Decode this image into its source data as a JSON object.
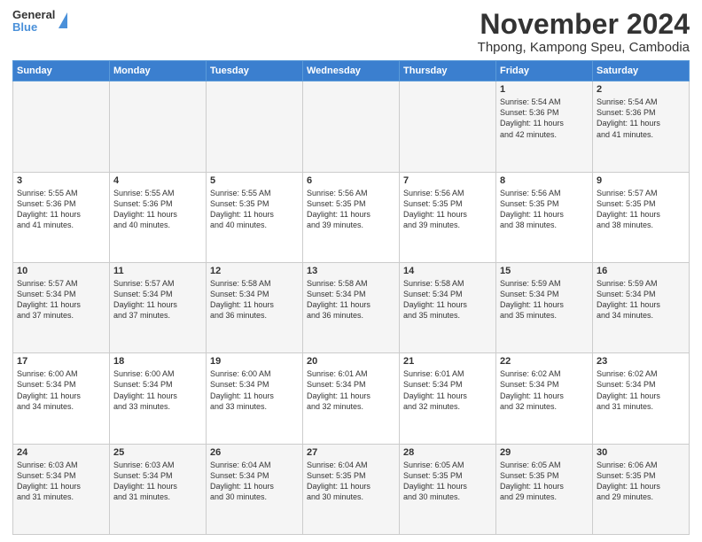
{
  "header": {
    "logo_line1": "General",
    "logo_line2": "Blue",
    "title": "November 2024",
    "subtitle": "Thpong, Kampong Speu, Cambodia"
  },
  "weekdays": [
    "Sunday",
    "Monday",
    "Tuesday",
    "Wednesday",
    "Thursday",
    "Friday",
    "Saturday"
  ],
  "weeks": [
    [
      {
        "day": "",
        "info": ""
      },
      {
        "day": "",
        "info": ""
      },
      {
        "day": "",
        "info": ""
      },
      {
        "day": "",
        "info": ""
      },
      {
        "day": "",
        "info": ""
      },
      {
        "day": "1",
        "info": "Sunrise: 5:54 AM\nSunset: 5:36 PM\nDaylight: 11 hours\nand 42 minutes."
      },
      {
        "day": "2",
        "info": "Sunrise: 5:54 AM\nSunset: 5:36 PM\nDaylight: 11 hours\nand 41 minutes."
      }
    ],
    [
      {
        "day": "3",
        "info": "Sunrise: 5:55 AM\nSunset: 5:36 PM\nDaylight: 11 hours\nand 41 minutes."
      },
      {
        "day": "4",
        "info": "Sunrise: 5:55 AM\nSunset: 5:36 PM\nDaylight: 11 hours\nand 40 minutes."
      },
      {
        "day": "5",
        "info": "Sunrise: 5:55 AM\nSunset: 5:35 PM\nDaylight: 11 hours\nand 40 minutes."
      },
      {
        "day": "6",
        "info": "Sunrise: 5:56 AM\nSunset: 5:35 PM\nDaylight: 11 hours\nand 39 minutes."
      },
      {
        "day": "7",
        "info": "Sunrise: 5:56 AM\nSunset: 5:35 PM\nDaylight: 11 hours\nand 39 minutes."
      },
      {
        "day": "8",
        "info": "Sunrise: 5:56 AM\nSunset: 5:35 PM\nDaylight: 11 hours\nand 38 minutes."
      },
      {
        "day": "9",
        "info": "Sunrise: 5:57 AM\nSunset: 5:35 PM\nDaylight: 11 hours\nand 38 minutes."
      }
    ],
    [
      {
        "day": "10",
        "info": "Sunrise: 5:57 AM\nSunset: 5:34 PM\nDaylight: 11 hours\nand 37 minutes."
      },
      {
        "day": "11",
        "info": "Sunrise: 5:57 AM\nSunset: 5:34 PM\nDaylight: 11 hours\nand 37 minutes."
      },
      {
        "day": "12",
        "info": "Sunrise: 5:58 AM\nSunset: 5:34 PM\nDaylight: 11 hours\nand 36 minutes."
      },
      {
        "day": "13",
        "info": "Sunrise: 5:58 AM\nSunset: 5:34 PM\nDaylight: 11 hours\nand 36 minutes."
      },
      {
        "day": "14",
        "info": "Sunrise: 5:58 AM\nSunset: 5:34 PM\nDaylight: 11 hours\nand 35 minutes."
      },
      {
        "day": "15",
        "info": "Sunrise: 5:59 AM\nSunset: 5:34 PM\nDaylight: 11 hours\nand 35 minutes."
      },
      {
        "day": "16",
        "info": "Sunrise: 5:59 AM\nSunset: 5:34 PM\nDaylight: 11 hours\nand 34 minutes."
      }
    ],
    [
      {
        "day": "17",
        "info": "Sunrise: 6:00 AM\nSunset: 5:34 PM\nDaylight: 11 hours\nand 34 minutes."
      },
      {
        "day": "18",
        "info": "Sunrise: 6:00 AM\nSunset: 5:34 PM\nDaylight: 11 hours\nand 33 minutes."
      },
      {
        "day": "19",
        "info": "Sunrise: 6:00 AM\nSunset: 5:34 PM\nDaylight: 11 hours\nand 33 minutes."
      },
      {
        "day": "20",
        "info": "Sunrise: 6:01 AM\nSunset: 5:34 PM\nDaylight: 11 hours\nand 32 minutes."
      },
      {
        "day": "21",
        "info": "Sunrise: 6:01 AM\nSunset: 5:34 PM\nDaylight: 11 hours\nand 32 minutes."
      },
      {
        "day": "22",
        "info": "Sunrise: 6:02 AM\nSunset: 5:34 PM\nDaylight: 11 hours\nand 32 minutes."
      },
      {
        "day": "23",
        "info": "Sunrise: 6:02 AM\nSunset: 5:34 PM\nDaylight: 11 hours\nand 31 minutes."
      }
    ],
    [
      {
        "day": "24",
        "info": "Sunrise: 6:03 AM\nSunset: 5:34 PM\nDaylight: 11 hours\nand 31 minutes."
      },
      {
        "day": "25",
        "info": "Sunrise: 6:03 AM\nSunset: 5:34 PM\nDaylight: 11 hours\nand 31 minutes."
      },
      {
        "day": "26",
        "info": "Sunrise: 6:04 AM\nSunset: 5:34 PM\nDaylight: 11 hours\nand 30 minutes."
      },
      {
        "day": "27",
        "info": "Sunrise: 6:04 AM\nSunset: 5:35 PM\nDaylight: 11 hours\nand 30 minutes."
      },
      {
        "day": "28",
        "info": "Sunrise: 6:05 AM\nSunset: 5:35 PM\nDaylight: 11 hours\nand 30 minutes."
      },
      {
        "day": "29",
        "info": "Sunrise: 6:05 AM\nSunset: 5:35 PM\nDaylight: 11 hours\nand 29 minutes."
      },
      {
        "day": "30",
        "info": "Sunrise: 6:06 AM\nSunset: 5:35 PM\nDaylight: 11 hours\nand 29 minutes."
      }
    ]
  ]
}
